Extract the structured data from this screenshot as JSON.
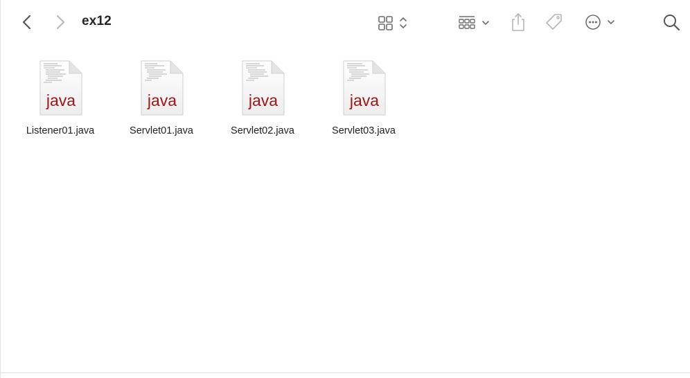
{
  "window": {
    "title": "ex12"
  },
  "toolbar": {
    "back_icon": "chevron-left-icon",
    "forward_icon": "chevron-right-icon",
    "view_icon": "icon-grid-icon",
    "group_icon": "group-by-icon",
    "share_icon": "share-icon",
    "tag_icon": "tag-icon",
    "more_icon": "ellipsis-circle-icon",
    "search_icon": "magnifier-icon"
  },
  "files": [
    {
      "name": "Listener01.java",
      "ext": "java"
    },
    {
      "name": "Servlet01.java",
      "ext": "java"
    },
    {
      "name": "Servlet02.java",
      "ext": "java"
    },
    {
      "name": "Servlet03.java",
      "ext": "java"
    }
  ],
  "colors": {
    "java_label": "#a31515",
    "toolbar_icon": "#6e6e6e",
    "disabled_icon": "#b5b5b5"
  }
}
